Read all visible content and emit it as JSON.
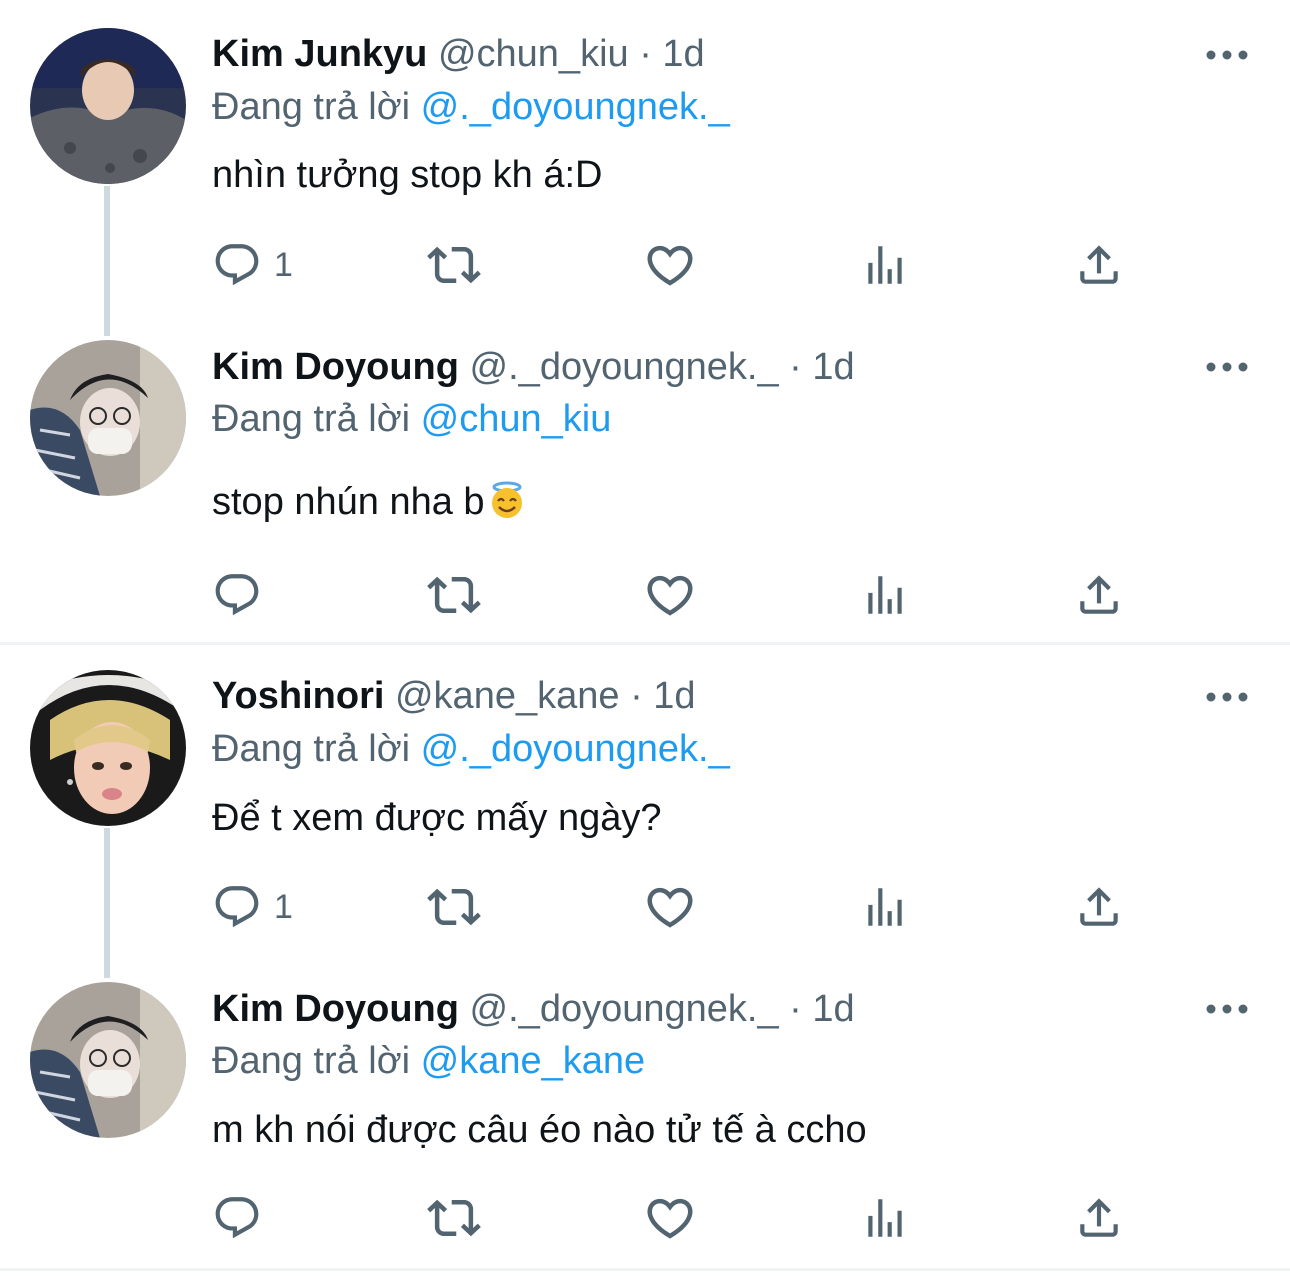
{
  "reply_prefix": "Đang trả lời",
  "tweets": [
    {
      "name": "Kim Junkyu",
      "handle": "@chun_kiu",
      "separator": "·",
      "time": "1d",
      "reply_to": "@._doyoungnek._",
      "text": "nhìn tưởng stop kh á:D",
      "reply_count": "1"
    },
    {
      "name": "Kim Doyoung",
      "handle": "@._doyoungnek._",
      "separator": "·",
      "time": "1d",
      "reply_to": "@chun_kiu",
      "text": "stop nhún nha b",
      "emoji": "smiling-face-with-halo",
      "reply_count": ""
    },
    {
      "name": "Yoshinori",
      "handle": "@kane_kane",
      "separator": "·",
      "time": "1d",
      "reply_to": "@._doyoungnek._",
      "text": "Để t xem được mấy ngày?",
      "reply_count": "1"
    },
    {
      "name": "Kim Doyoung",
      "handle": "@._doyoungnek._",
      "separator": "·",
      "time": "1d",
      "reply_to": "@kane_kane",
      "text": "m kh nói được câu éo nào tử tế à ccho",
      "reply_count": ""
    }
  ],
  "colors": {
    "text": "#0f1419",
    "secondary": "#536471",
    "mention": "#1d9bf0",
    "thread_line": "#cfd9de",
    "divider": "#eff3f4"
  },
  "icons": [
    "reply-icon",
    "retweet-icon",
    "like-icon",
    "analytics-icon",
    "share-icon",
    "more-icon"
  ]
}
